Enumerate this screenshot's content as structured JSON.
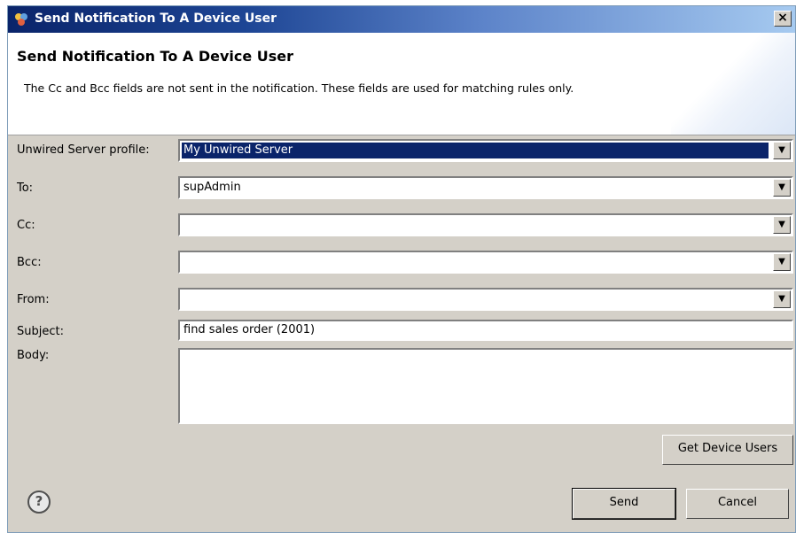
{
  "window": {
    "title": "Send Notification To A Device User",
    "close_label": "×"
  },
  "header": {
    "title": "Send Notification To A Device User",
    "description": "The Cc and Bcc fields are not sent in the notification.  These fields are used for matching rules only."
  },
  "form": {
    "profile_label": "Unwired Server profile:",
    "profile_value": "My Unwired Server",
    "to_label": "To:",
    "to_value": "supAdmin",
    "cc_label": "Cc:",
    "cc_value": "",
    "bcc_label": "Bcc:",
    "bcc_value": "",
    "from_label": "From:",
    "from_value": "",
    "subject_label": "Subject:",
    "subject_value": "find sales order (2001)",
    "body_label": "Body:",
    "body_value": ""
  },
  "buttons": {
    "get_device_users": "Get Device Users",
    "send": "Send",
    "cancel": "Cancel",
    "help": "?"
  },
  "icons": {
    "app": "notification-app-icon",
    "help": "help-icon",
    "dropdown": "chevron-down-icon"
  }
}
